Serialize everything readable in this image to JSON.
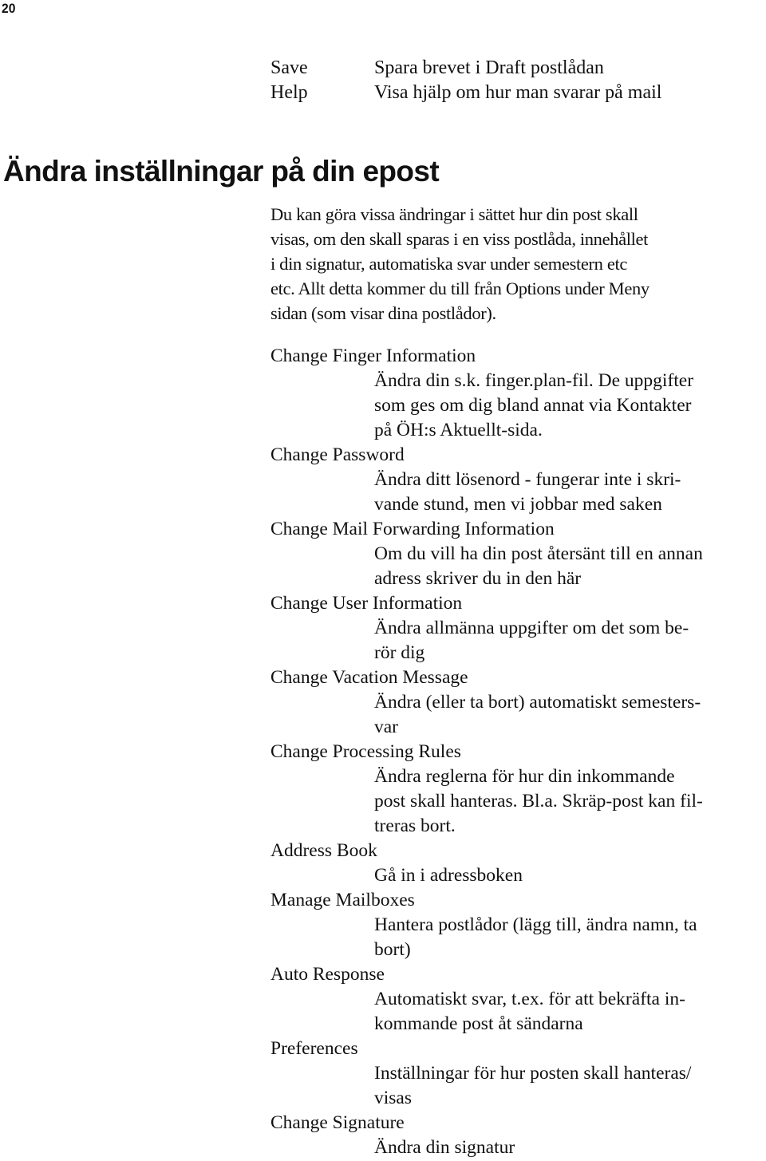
{
  "page_number": "20",
  "commands": [
    {
      "key": "Save",
      "description": "Spara brevet i Draft postlådan"
    },
    {
      "key": "Help",
      "description": "Visa hjälp om hur man svarar på mail"
    }
  ],
  "section": {
    "heading": "Ändra inställningar på din epost",
    "intro_lines": [
      "Du kan göra vissa ändringar i sättet hur din post skall",
      "visas, om den skall sparas i en viss postlåda, innehållet",
      "i din signatur, automatiska svar under semestern etc",
      "etc. Allt detta kommer du till från Options under Meny",
      "sidan (som visar dina postlådor)."
    ]
  },
  "options": [
    {
      "label": "Change Finger Information",
      "description_lines": [
        "Ändra din s.k. finger.plan-fil. De uppgifter",
        "som ges om dig bland annat via Kontakter",
        "på ÖH:s Aktuellt-sida."
      ]
    },
    {
      "label": "Change Password",
      "description_lines": [
        "Ändra ditt lösenord - fungerar inte i skri-",
        "vande stund, men vi jobbar med saken"
      ]
    },
    {
      "label": "Change Mail Forwarding Information",
      "description_lines": [
        "Om du vill ha din post återsänt till en annan",
        "adress skriver du in den här"
      ]
    },
    {
      "label": "Change User Information",
      "description_lines": [
        "Ändra allmänna uppgifter om det som be-",
        "rör dig"
      ]
    },
    {
      "label": "Change Vacation Message",
      "description_lines": [
        "Ändra (eller ta bort) automatiskt semesters-",
        "var"
      ]
    },
    {
      "label": "Change Processing Rules",
      "description_lines": [
        "Ändra reglerna för hur din inkommande",
        "post skall hanteras. Bl.a. Skräp-post kan fil-",
        "treras bort."
      ]
    },
    {
      "label": "Address Book",
      "description_lines": [
        "Gå in i adressboken"
      ]
    },
    {
      "label": "Manage Mailboxes",
      "description_lines": [
        "Hantera postlådor (lägg till, ändra namn, ta",
        "bort)"
      ]
    },
    {
      "label": "Auto Response",
      "description_lines": [
        "Automatiskt svar, t.ex. för att bekräfta in-",
        "kommande post åt sändarna"
      ]
    },
    {
      "label": "Preferences",
      "description_lines": [
        "Inställningar för hur posten skall hanteras/",
        "visas"
      ]
    },
    {
      "label": "Change Signature",
      "description_lines": [
        "Ändra din signatur"
      ]
    }
  ]
}
